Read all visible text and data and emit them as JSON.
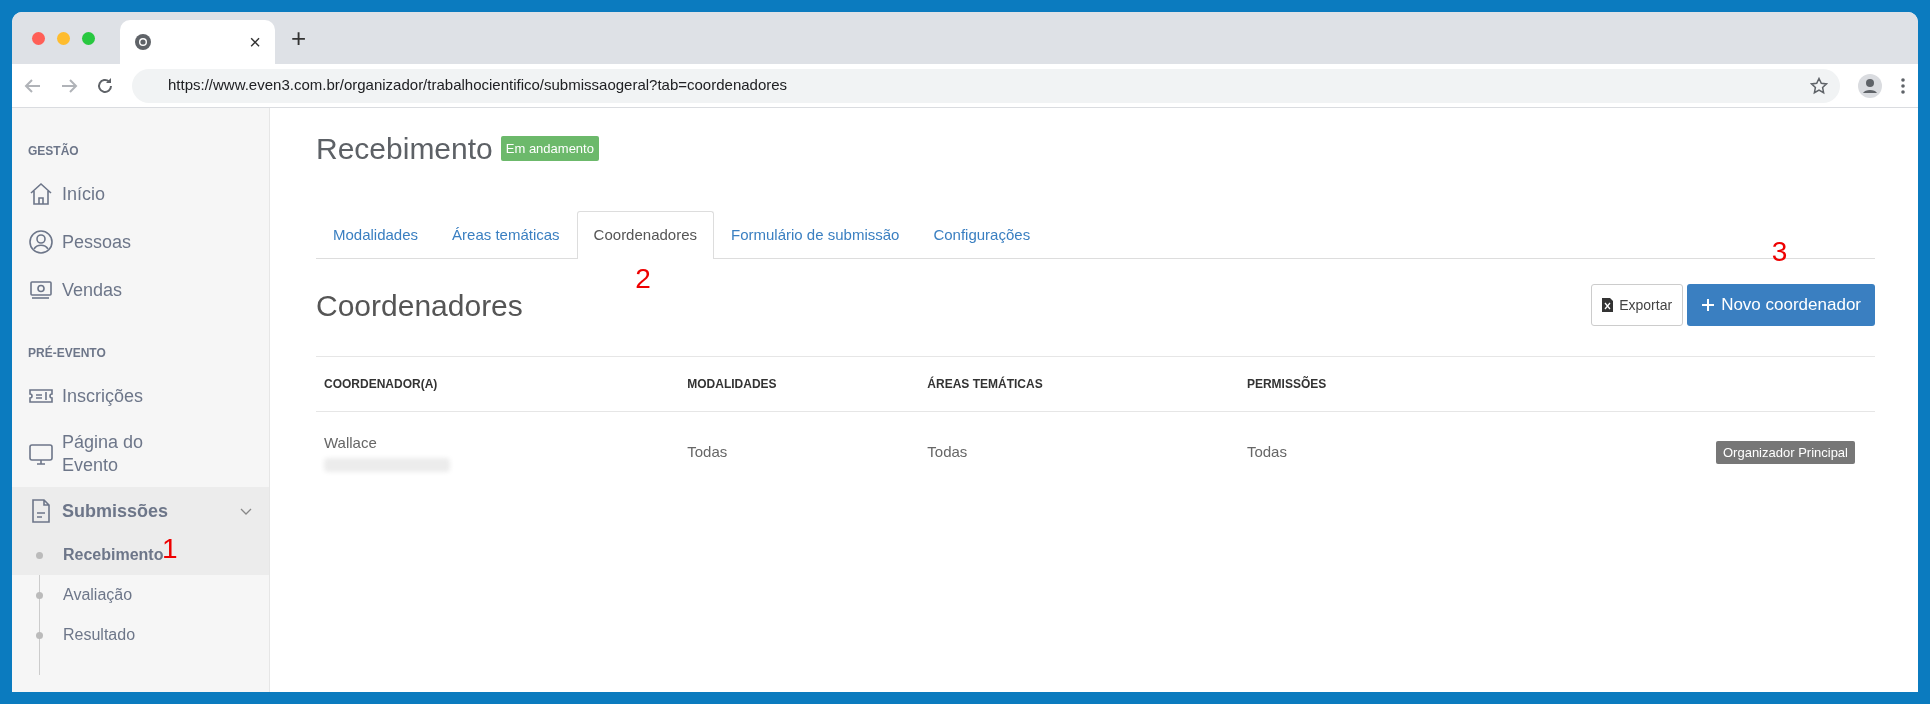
{
  "browser": {
    "url": "https://www.even3.com.br/organizador/trabalhocientifico/submissaogeral?tab=coordenadores",
    "tab_close": "×",
    "new_tab": "+"
  },
  "sidebar": {
    "sections": [
      {
        "heading": "GESTÃO",
        "items": [
          {
            "label": "Início",
            "selected": false
          },
          {
            "label": "Pessoas",
            "selected": false
          },
          {
            "label": "Vendas",
            "selected": false
          }
        ]
      },
      {
        "heading": "PRÉ-EVENTO",
        "items": [
          {
            "label": "Inscrições",
            "selected": false
          },
          {
            "label": "Página do Evento",
            "selected": false
          },
          {
            "label": "Submissões",
            "selected": true,
            "expanded": true,
            "children": [
              {
                "label": "Recebimento",
                "selected": true
              },
              {
                "label": "Avaliação",
                "selected": false
              },
              {
                "label": "Resultado",
                "selected": false
              }
            ]
          }
        ]
      }
    ]
  },
  "page": {
    "title": "Recebimento",
    "status_badge": "Em andamento",
    "tabs": [
      {
        "label": "Modalidades",
        "selected": false
      },
      {
        "label": "Áreas temáticas",
        "selected": false
      },
      {
        "label": "Coordenadores",
        "selected": true
      },
      {
        "label": "Formulário de submissão",
        "selected": false
      },
      {
        "label": "Configurações",
        "selected": false
      }
    ],
    "section_title": "Coordenadores",
    "buttons": [
      {
        "label": "Exportar",
        "kind": "export"
      },
      {
        "label": "Novo coordenador",
        "kind": "primary"
      }
    ],
    "table": {
      "columns": [
        "COORDENADOR(A)",
        "MODALIDADES",
        "ÁREAS TEMÁTICAS",
        "PERMISSÕES"
      ],
      "rows": [
        {
          "cells": [
            "Wallace",
            "Todas",
            "Todas",
            "Todas"
          ],
          "email_redacted": true,
          "role_badge": "Organizador Principal"
        }
      ]
    }
  },
  "annotations": [
    {
      "text": "1"
    },
    {
      "text": "2"
    },
    {
      "text": "3"
    }
  ]
}
